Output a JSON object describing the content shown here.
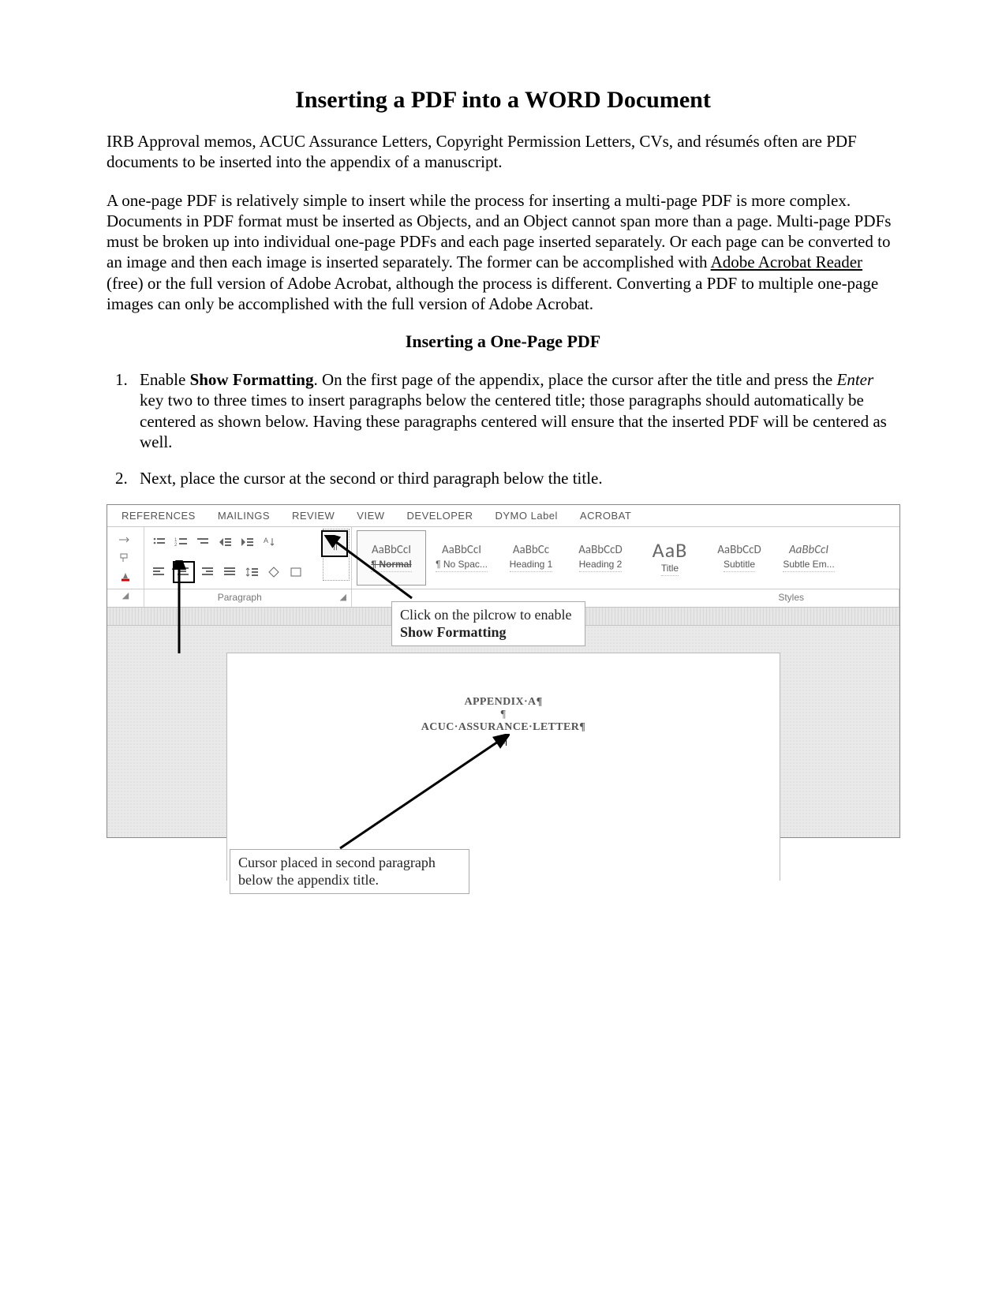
{
  "title": "Inserting a PDF into a WORD Document",
  "intro1": "IRB Approval memos, ACUC Assurance Letters, Copyright Permission Letters, CVs, and résumés often are PDF documents to be inserted into the appendix of a manuscript.",
  "intro2a": "A one-page PDF is relatively simple to insert while the process for inserting a multi-page PDF is more complex. Documents in PDF format must be inserted as Objects, and an Object cannot span more than a page. Multi-page PDFs must be broken up into individual one-page PDFs and each page inserted separately. Or each page can be converted to an image and then each image is inserted separately. The former can be accomplished with ",
  "intro2_link": "Adobe Acrobat Reader",
  "intro2b": " (free) or the full version of Adobe Acrobat, although the process is different. Converting a PDF to multiple one-page images can only be accomplished with the full version of Adobe Acrobat.",
  "section_title": "Inserting a One-Page PDF",
  "step1_a": "Enable ",
  "step1_bold": "Show Formatting",
  "step1_b": ". On the first page of the appendix, place the cursor after the title and press the ",
  "step1_ital": "Enter",
  "step1_c": " key two to three times to insert paragraphs below the centered title; those paragraphs should automatically be centered as shown below. Having these paragraphs centered will ensure that the inserted PDF will be centered as well.",
  "step2": "Next, place the cursor at the second or third paragraph below the title.",
  "ribbon": {
    "tabs": [
      "REFERENCES",
      "MAILINGS",
      "REVIEW",
      "VIEW",
      "DEVELOPER",
      "DYMO Label",
      "ACROBAT"
    ],
    "pilcrow": "¶",
    "group_paragraph": "Paragraph",
    "group_styles": "Styles",
    "styles": [
      {
        "preview": "AaBbCcI",
        "label": "¶ Normal",
        "sel": true
      },
      {
        "preview": "AaBbCcI",
        "label": "¶ No Spac..."
      },
      {
        "preview": "AaBbCc",
        "label": "Heading 1"
      },
      {
        "preview": "AaBbCcD",
        "label": "Heading 2"
      },
      {
        "preview": "AaB",
        "label": "Title",
        "big": true
      },
      {
        "preview": "AaBbCcD",
        "label": "Subtitle"
      },
      {
        "preview": "AaBbCcI",
        "label": "Subtle Em...",
        "ital": true
      }
    ]
  },
  "doc": {
    "l1": "APPENDIX·A¶",
    "l2": "¶",
    "l3": "ACUC·ASSURANCE·LETTER¶",
    "l4": "¶"
  },
  "callout1_a": "Click on the pilcrow to enable ",
  "callout1_bold": "Show Formatting",
  "callout2": "Cursor placed in second paragraph below the appendix title."
}
